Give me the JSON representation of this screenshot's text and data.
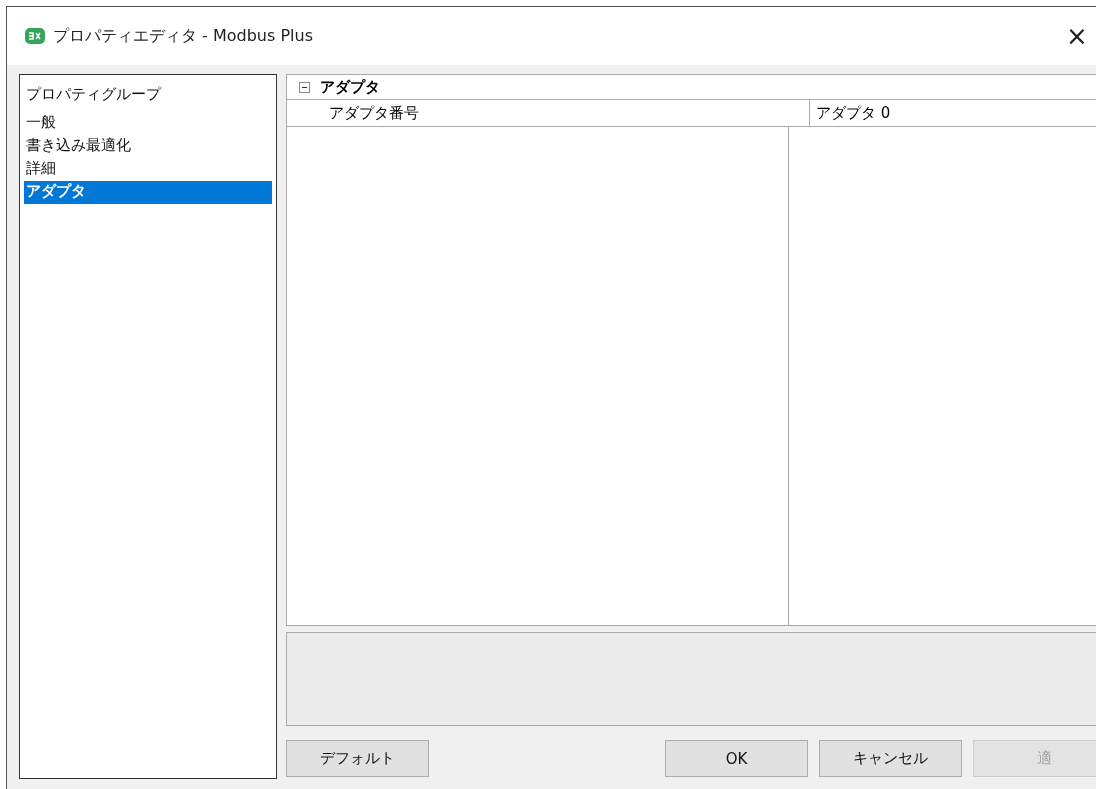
{
  "window": {
    "title": "プロパティエディタ - Modbus Plus",
    "close": "×"
  },
  "sidebar": {
    "header": "プロパティグループ",
    "items": [
      {
        "label": "一般",
        "selected": false
      },
      {
        "label": "書き込み最適化",
        "selected": false
      },
      {
        "label": "詳細",
        "selected": false
      },
      {
        "label": "アダプタ",
        "selected": true
      }
    ]
  },
  "property_grid": {
    "category": {
      "label": "アダプタ",
      "expanded": true
    },
    "rows": [
      {
        "name": "アダプタ番号",
        "value": "アダプタ 0"
      }
    ]
  },
  "buttons": [
    {
      "label": "デフォルト",
      "disabled": false
    },
    {
      "label": "OK",
      "disabled": false
    },
    {
      "label": "キャンセル",
      "disabled": false
    },
    {
      "label": "適",
      "disabled": true
    }
  ]
}
